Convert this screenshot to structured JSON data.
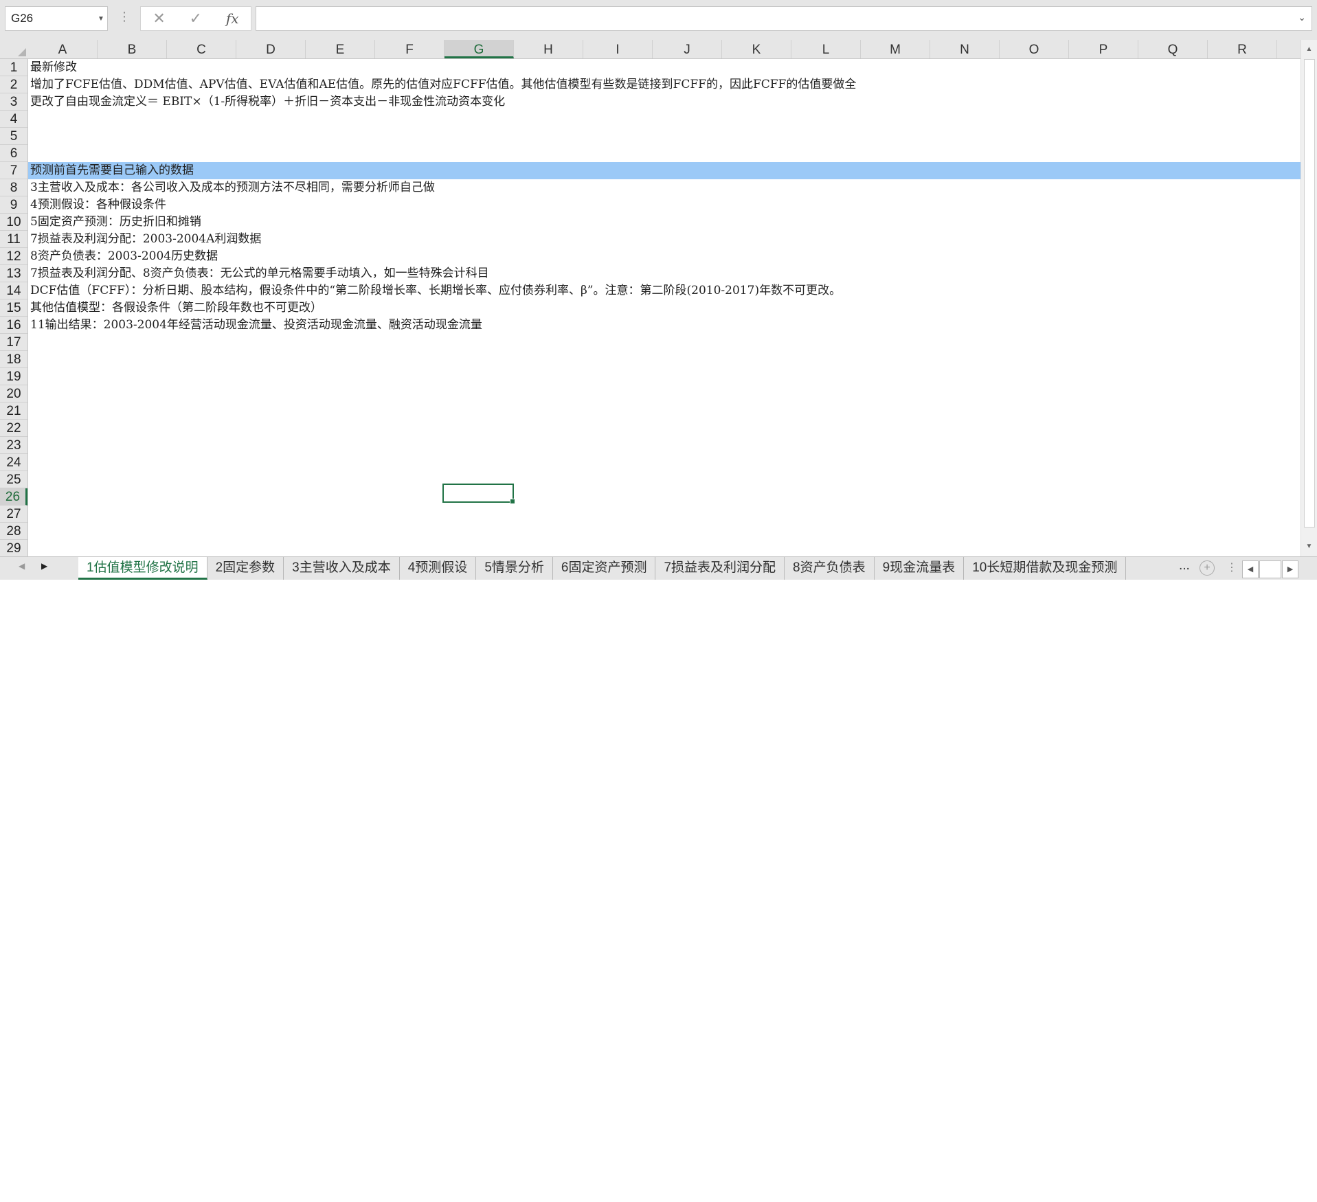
{
  "formula_bar": {
    "name_box": "G26",
    "cancel_icon": "✕",
    "enter_icon": "✓",
    "fx_label": "fx",
    "formula": ""
  },
  "columns": [
    "A",
    "B",
    "C",
    "D",
    "E",
    "F",
    "G",
    "H",
    "I",
    "J",
    "K",
    "L",
    "M",
    "N",
    "O",
    "P",
    "Q",
    "R"
  ],
  "selected_column": "G",
  "selected_row": 26,
  "rows": [
    {
      "n": 1,
      "a": "最新修改"
    },
    {
      "n": 2,
      "a": "增加了FCFE估值、DDM估值、APV估值、EVA估值和AE估值。原先的估值对应FCFF估值。其他估值模型有些数是链接到FCFF的，因此FCFF的估值要做全"
    },
    {
      "n": 3,
      "a": "更改了自由现金流定义＝ EBIT×（1-所得税率）＋折旧－资本支出－非现金性流动资本变化"
    },
    {
      "n": 4,
      "a": ""
    },
    {
      "n": 5,
      "a": ""
    },
    {
      "n": 6,
      "a": ""
    },
    {
      "n": 7,
      "a": "预测前首先需要自己输入的数据",
      "highlight": true
    },
    {
      "n": 8,
      "a": "3主营收入及成本：各公司收入及成本的预测方法不尽相同，需要分析师自己做"
    },
    {
      "n": 9,
      "a": "4预测假设：各种假设条件"
    },
    {
      "n": 10,
      "a": "5固定资产预测：历史折旧和摊销"
    },
    {
      "n": 11,
      "a": "7损益表及利润分配：2003-2004A利润数据"
    },
    {
      "n": 12,
      "a": "8资产负债表：2003-2004历史数据"
    },
    {
      "n": 13,
      "a": "7损益表及利润分配、8资产负债表：无公式的单元格需要手动填入，如一些特殊会计科目"
    },
    {
      "n": 14,
      "a": "DCF估值（FCFF）：分析日期、股本结构，假设条件中的“第二阶段增长率、长期增长率、应付债券利率、β”。注意：第二阶段(2010-2017)年数不可更改。"
    },
    {
      "n": 15,
      "a": "其他估值模型：各假设条件（第二阶段年数也不可更改）"
    },
    {
      "n": 16,
      "a": "11输出结果：2003-2004年经营活动现金流量、投资活动现金流量、融资活动现金流量"
    },
    {
      "n": 17,
      "a": ""
    },
    {
      "n": 18,
      "a": ""
    },
    {
      "n": 19,
      "a": ""
    },
    {
      "n": 20,
      "a": ""
    },
    {
      "n": 21,
      "a": ""
    },
    {
      "n": 22,
      "a": ""
    },
    {
      "n": 23,
      "a": ""
    },
    {
      "n": 24,
      "a": ""
    },
    {
      "n": 25,
      "a": ""
    },
    {
      "n": 26,
      "a": ""
    },
    {
      "n": 27,
      "a": ""
    },
    {
      "n": 28,
      "a": ""
    },
    {
      "n": 29,
      "a": ""
    }
  ],
  "sheet_tabs": [
    {
      "label": "1估值模型修改说明",
      "active": true
    },
    {
      "label": "2固定参数"
    },
    {
      "label": "3主营收入及成本"
    },
    {
      "label": "4预测假设"
    },
    {
      "label": "5情景分析"
    },
    {
      "label": "6固定资产预测"
    },
    {
      "label": "7损益表及利润分配"
    },
    {
      "label": "8资产负债表"
    },
    {
      "label": "9现金流量表"
    },
    {
      "label": "10长短期借款及现金预测"
    }
  ],
  "tab_overflow_label": "...",
  "add_sheet_icon": "+",
  "colors": {
    "accent": "#217346",
    "highlight_row": "#9bc9f7",
    "chrome": "#e6e6e6"
  }
}
